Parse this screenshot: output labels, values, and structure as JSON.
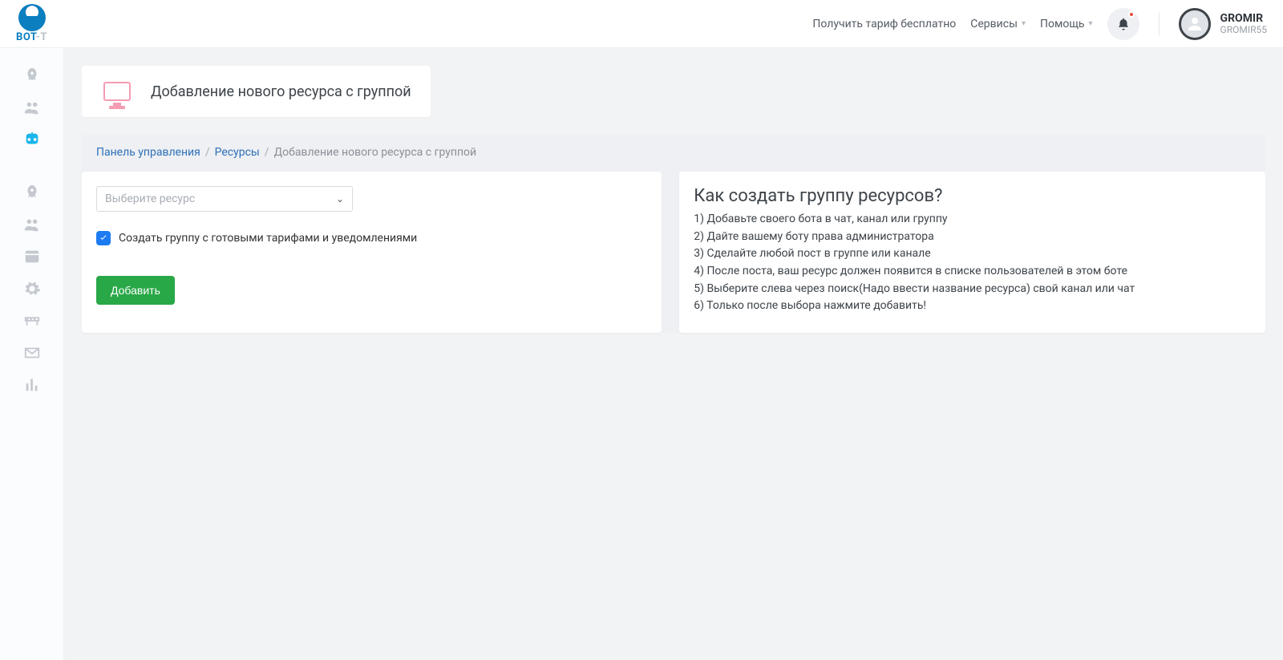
{
  "brand": {
    "name": "BOT",
    "suffix": "-T"
  },
  "topbar": {
    "free_tariff": "Получить тариф бесплатно",
    "services": "Сервисы",
    "help": "Помощь",
    "user": {
      "name": "GROMIR",
      "login": "GROMIR55"
    }
  },
  "page": {
    "title": "Добавление нового ресурса с группой"
  },
  "breadcrumb": {
    "dashboard": "Панель управления",
    "resources": "Ресурсы",
    "current": "Добавление нового ресурса с группой"
  },
  "form": {
    "select_placeholder": "Выберите ресурс",
    "checkbox_label": "Создать группу с готовыми тарифами и уведомлениями",
    "submit_label": "Добавить"
  },
  "help": {
    "title": "Как создать группу ресурсов?",
    "steps": {
      "s1": "1) Добавьте своего бота в чат, канал или группу",
      "s2": "2) Дайте вашему боту права администратора",
      "s3": "3) Сделайте любой пост в группе или канале",
      "s4": "4) После поста, ваш ресурс должен появится в списке пользователей в этом боте",
      "s5": "5) Выберите слева через поиск(Надо ввести название ресурса) свой канал или чат",
      "s6": "6) Только после выбора нажмите добавить!"
    }
  }
}
